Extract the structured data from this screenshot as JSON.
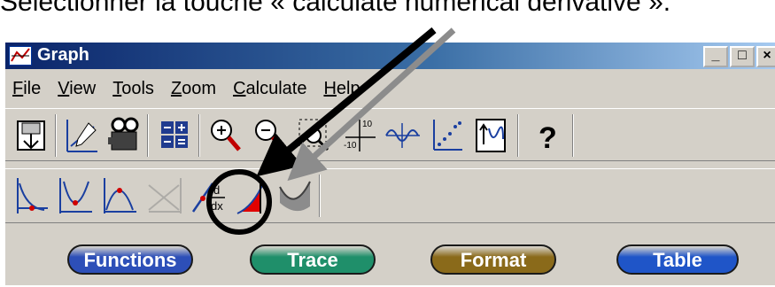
{
  "caption": "Selectionner la touche « calculate numerical derivative ».",
  "window": {
    "title": "Graph",
    "controls": {
      "minimize": "_",
      "maximize": "□",
      "close": "×"
    }
  },
  "menu": [
    {
      "label": "File",
      "mnemonic": "F",
      "rest": "ile"
    },
    {
      "label": "View",
      "mnemonic": "V",
      "rest": "iew"
    },
    {
      "label": "Tools",
      "mnemonic": "T",
      "rest": "ools"
    },
    {
      "label": "Zoom",
      "mnemonic": "Z",
      "rest": "oom"
    },
    {
      "label": "Calculate",
      "mnemonic": "C",
      "rest": "alculate"
    },
    {
      "label": "Help",
      "mnemonic": "H",
      "rest": "elp"
    }
  ],
  "toolbar1": {
    "icons": [
      "save-graph-icon",
      "draw-line-icon",
      "camera-icon",
      "grid-view-icon",
      "zoom-in-icon",
      "zoom-out-icon",
      "zoom-box-icon",
      "zoom-standard-icon",
      "zoom-trig-icon",
      "zoom-data-icon",
      "zoom-fit-icon",
      "help-icon"
    ],
    "help_label": "?",
    "axis_max_label": "10",
    "axis_min_label": "-10"
  },
  "toolbar2": {
    "icons": [
      "zero-icon",
      "minimum-icon",
      "maximum-icon",
      "intersection-icon",
      "numerical-derivative-icon",
      "integral-icon",
      "arc-length-icon"
    ],
    "derivative_label_top": "d",
    "derivative_label_bottom": "dx"
  },
  "buttons": [
    {
      "label": "Functions",
      "color": "#2d4fb8"
    },
    {
      "label": "Trace",
      "color": "#1f8f6a"
    },
    {
      "label": "Format",
      "color": "#8a6a1a"
    },
    {
      "label": "Table",
      "color": "#1f55c8"
    }
  ],
  "annotation": {
    "highlighted_tool": "numerical-derivative",
    "arrow_colors": [
      "#000000",
      "#8c8c8c"
    ]
  }
}
